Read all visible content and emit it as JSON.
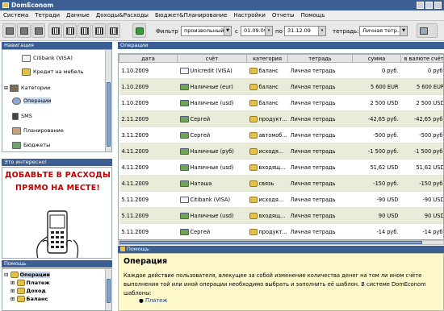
{
  "window": {
    "title": "DomEconom"
  },
  "menu": [
    "Система",
    "Тетради",
    "Данные",
    "Доходы&Расходы",
    "Бюджет&Планирование",
    "Настройки",
    "Отчеты",
    "Помощь"
  ],
  "toolbar": {
    "filter_label": "Фильтр",
    "filter_value": "произвольный",
    "from_label": "с",
    "from_date": "01.09.09",
    "to_label": "по",
    "to_date": "31.12.09",
    "notebook_label": "тетрадь:",
    "notebook_value": "Личная тетр..."
  },
  "navigation": {
    "header": "Навигация",
    "items": [
      {
        "label": "Citibank (VISA)",
        "icon": "card-icon"
      },
      {
        "label": "Кредит на мебель",
        "icon": "loan-icon"
      },
      {
        "label": "Категории",
        "icon": "categories-icon"
      },
      {
        "label": "Операции",
        "icon": "operations-icon",
        "selected": true
      },
      {
        "label": "SMS",
        "icon": "sms-icon"
      },
      {
        "label": "Планирование",
        "icon": "planning-icon"
      },
      {
        "label": "Бюджеты",
        "icon": "budget-icon"
      }
    ]
  },
  "promo": {
    "header": "Это интересно!",
    "line1": "ДОБАВЬТЕ В РАСХОДЫ",
    "line2": "ПРЯМО НА МЕСТЕ!"
  },
  "help_tree": {
    "header": "Помощь",
    "items": [
      "Операции",
      "Платеж",
      "Доход",
      "Баланс"
    ]
  },
  "operations": {
    "header": "Операции",
    "columns": [
      "дата",
      "счёт",
      "категория",
      "тетрадь",
      "сумма",
      "в валюте счёт"
    ],
    "rows": [
      {
        "date": "1.10.2009",
        "account": "Unicredit (VISA)",
        "category": "баланс",
        "notebook": "Личная тетрадь",
        "amount": "0 руб.",
        "in_currency": "0 руб."
      },
      {
        "date": "1.10.2009",
        "account": "Наличные (eur)",
        "category": "баланс",
        "notebook": "Личная тетрадь",
        "amount": "5 600 EUR",
        "in_currency": "5 600 EUR"
      },
      {
        "date": "1.10.2009",
        "account": "Наличные (usd)",
        "category": "баланс",
        "notebook": "Личная тетрадь",
        "amount": "2 500 USD",
        "in_currency": "2 500 USD"
      },
      {
        "date": "2.11.2009",
        "account": "Сергей",
        "category": "продукт...",
        "notebook": "Личная тетрадь",
        "amount": "-42,65 руб.",
        "in_currency": "-42,65 руб."
      },
      {
        "date": "3.11.2009",
        "account": "Сергей",
        "category": "автомоб...",
        "notebook": "Личная тетрадь",
        "amount": "-500 руб.",
        "in_currency": "-500 руб."
      },
      {
        "date": "4.11.2009",
        "account": "Наличные (руб)",
        "category": "исходя...",
        "notebook": "Личная тетрадь",
        "amount": "-1 500 руб.",
        "in_currency": "-1 500 руб."
      },
      {
        "date": "4.11.2009",
        "account": "Наличные (usd)",
        "category": "входящ...",
        "notebook": "Личная тетрадь",
        "amount": "51,62 USD",
        "in_currency": "51,62 USD"
      },
      {
        "date": "4.11.2009",
        "account": "Наташа",
        "category": "связь",
        "notebook": "Личная тетрадь",
        "amount": "-150 руб.",
        "in_currency": "-150 руб."
      },
      {
        "date": "5.11.2009",
        "account": "Citibank (VISA)",
        "category": "исходя...",
        "notebook": "Личная тетрадь",
        "amount": "-90 USD",
        "in_currency": "-90 USD"
      },
      {
        "date": "5.11.2009",
        "account": "Наличные (usd)",
        "category": "входящ...",
        "notebook": "Личная тетрадь",
        "amount": "90 USD",
        "in_currency": "90 USD"
      },
      {
        "date": "5.11.2009",
        "account": "Сергей",
        "category": "продукт...",
        "notebook": "Личная тетрадь",
        "amount": "-14 руб.",
        "in_currency": "-14 руб."
      },
      {
        "date": "7.11.2009",
        "account": "Наличные (руб)",
        "category": "баланс",
        "notebook": "Личная тетрадь",
        "amount": "22 378 руб.",
        "in_currency": "22 378 руб."
      }
    ]
  },
  "help": {
    "header": "Помощь",
    "title": "Операция",
    "line1": "Каждое действие пользователя, влекущее за собой изменение количества денег на том ли ином счёте",
    "line2": "выполнения той или иной операции необходимо выбрать и заполнить её шаблон. В системе DomEconom",
    "line3": "шаблоны:",
    "bullet": "Платеж"
  },
  "colors": {
    "header_blue": "#3c5f93",
    "alt_row": "#e8ecd8",
    "help_bg": "#fdf8c9",
    "promo_red": "#c40000"
  }
}
